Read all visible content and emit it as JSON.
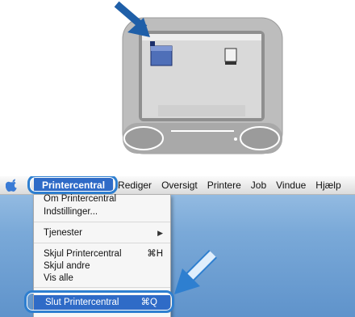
{
  "menubar": {
    "app_menu_label": "Printercentral",
    "menus": [
      "Rediger",
      "Oversigt",
      "Printere",
      "Job",
      "Vindue",
      "Hjælp"
    ]
  },
  "dropdown": {
    "items": {
      "about": "Om Printercentral",
      "preferences": "Indstillinger...",
      "services": "Tjenester",
      "hide": "Skjul Printercentral",
      "hide_shortcut": "⌘H",
      "hide_others": "Skjul andre",
      "show_all": "Vis alle",
      "quit": "Slut Printercentral",
      "quit_shortcut": "⌘Q"
    }
  },
  "colors": {
    "accent_blue": "#2e7fd0",
    "menu_selection": "#2f6bc7",
    "arrow_blue": "#1f5fa8"
  },
  "icons": {
    "apple_menu": "apple-logo-icon",
    "submenu": "triangle-right-icon",
    "pointer": "arrow-icon",
    "drive": "hard-drive-icon",
    "selected_drive": "cd-icon"
  }
}
